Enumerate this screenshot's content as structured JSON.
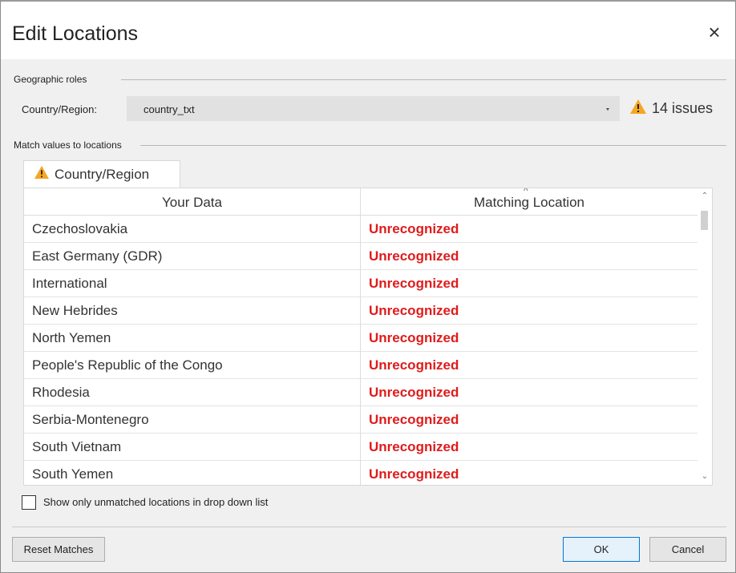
{
  "dialog": {
    "title": "Edit Locations",
    "close_label": "×"
  },
  "geographic_roles": {
    "section_label": "Geographic roles",
    "field_label": "Country/Region:",
    "selected_value": "country_txt",
    "issues_text": "14 issues"
  },
  "match_values": {
    "section_label": "Match values to locations",
    "tab_label": "Country/Region",
    "columns": [
      "Your Data",
      "Matching Location"
    ],
    "sort_caret": "^",
    "rows": [
      {
        "data": "Czechoslovakia",
        "match": "Unrecognized"
      },
      {
        "data": "East Germany (GDR)",
        "match": "Unrecognized"
      },
      {
        "data": "International",
        "match": "Unrecognized"
      },
      {
        "data": "New Hebrides",
        "match": "Unrecognized"
      },
      {
        "data": "North Yemen",
        "match": "Unrecognized"
      },
      {
        "data": "People's Republic of the Congo",
        "match": "Unrecognized"
      },
      {
        "data": "Rhodesia",
        "match": "Unrecognized"
      },
      {
        "data": "Serbia-Montenegro",
        "match": "Unrecognized"
      },
      {
        "data": "South Vietnam",
        "match": "Unrecognized"
      },
      {
        "data": "South Yemen",
        "match": "Unrecognized"
      }
    ]
  },
  "options": {
    "unmatched_only_label": "Show only unmatched locations in drop down list",
    "unmatched_only_checked": false
  },
  "buttons": {
    "reset": "Reset Matches",
    "ok": "OK",
    "cancel": "Cancel"
  },
  "colors": {
    "unrecognized": "#e01b1b",
    "warning": "#f5a623",
    "ok_border": "#0078d7"
  },
  "icons": {
    "warning": "warning-icon",
    "close": "close-icon",
    "dropdown": "chevron-down-icon"
  }
}
